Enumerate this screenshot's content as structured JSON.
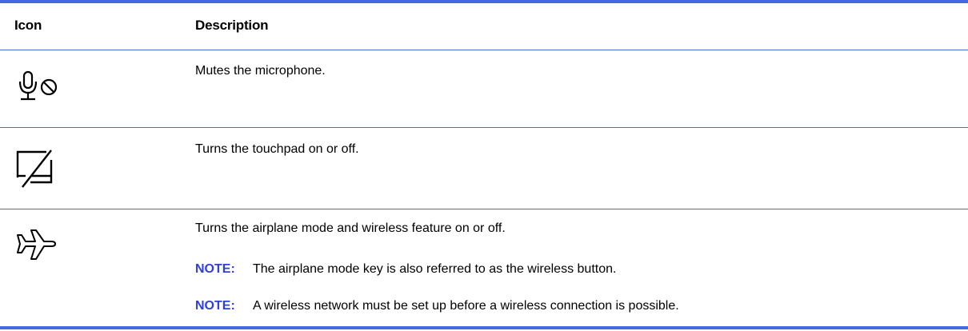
{
  "header": {
    "icon_col": "Icon",
    "description_col": "Description"
  },
  "rows": [
    {
      "icon": "microphone-mute-icon",
      "description": "Mutes the microphone."
    },
    {
      "icon": "touchpad-off-icon",
      "description": "Turns the touchpad on or off."
    },
    {
      "icon": "airplane-icon",
      "description": "Turns the airplane mode and wireless feature on or off.",
      "notes": [
        {
          "label": "NOTE:",
          "text": "The airplane mode key is also referred to as the wireless button."
        },
        {
          "label": "NOTE:",
          "text": "A wireless network must be set up before a wireless connection is possible."
        }
      ]
    }
  ],
  "colors": {
    "rule": "#4a67e3",
    "note_label": "#2f3ede"
  }
}
